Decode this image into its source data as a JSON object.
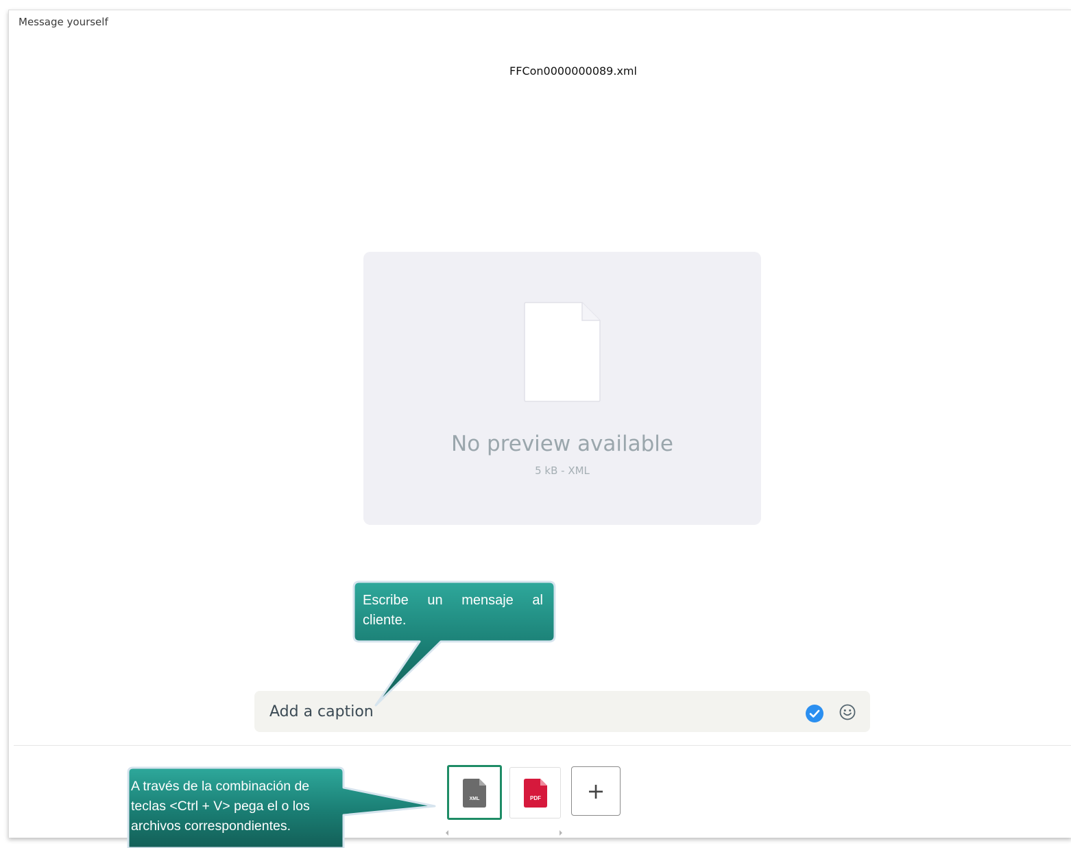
{
  "window": {
    "title": "Message yourself"
  },
  "file": {
    "name": "FFCon0000000089.xml",
    "preview_message": "No preview available",
    "meta": "5 kB - XML"
  },
  "caption": {
    "placeholder": "Add a caption"
  },
  "thumbnails": [
    {
      "type_label": "XML",
      "selected": true
    },
    {
      "type_label": "PDF",
      "selected": false
    }
  ],
  "add_button_label": "+",
  "callouts": {
    "caption_hint": "Escribe un mensaje al cliente.",
    "paste_hint": "A través de la combinación de teclas <Ctrl + V> pega el o los archivos correspondientes."
  },
  "colors": {
    "selected_border": "#1e8c66",
    "pdf_red": "#d6193c",
    "verified_blue": "#2b8ff0",
    "callout_teal": "#1f8a80"
  },
  "icons": {
    "caption_confirm": "check-circle-icon",
    "caption_emoji": "smiley-icon"
  }
}
